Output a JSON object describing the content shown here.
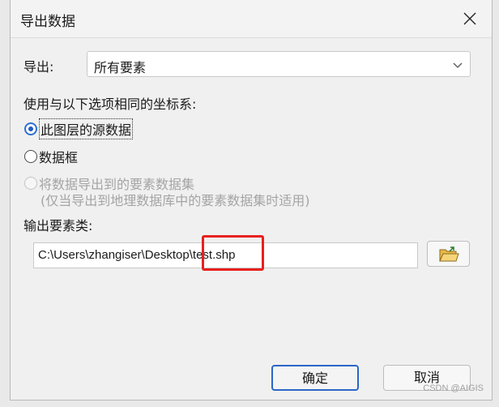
{
  "window": {
    "title": "导出数据",
    "close_icon": "close-icon"
  },
  "export": {
    "label": "导出:",
    "selected": "所有要素"
  },
  "coords": {
    "heading": "使用与以下选项相同的坐标系:",
    "options": [
      {
        "label": "此图层的源数据",
        "state": "selected"
      },
      {
        "label": "数据框",
        "state": "unselected"
      },
      {
        "label": "将数据导出到的要素数据集",
        "sub": "(仅当导出到地理数据库中的要素数据集时适用)",
        "state": "disabled"
      }
    ]
  },
  "output": {
    "label": "输出要素类:",
    "path": "C:\\Users\\zhangiser\\Desktop\\test.shp",
    "browse_icon": "open-folder-icon",
    "highlight_color": "#e8201e"
  },
  "buttons": {
    "ok": "确定",
    "cancel": "取消"
  },
  "watermark": "CSDN @AIGIS",
  "colors": {
    "accent": "#2b66c9",
    "disabled_text": "#a4a4a4"
  }
}
